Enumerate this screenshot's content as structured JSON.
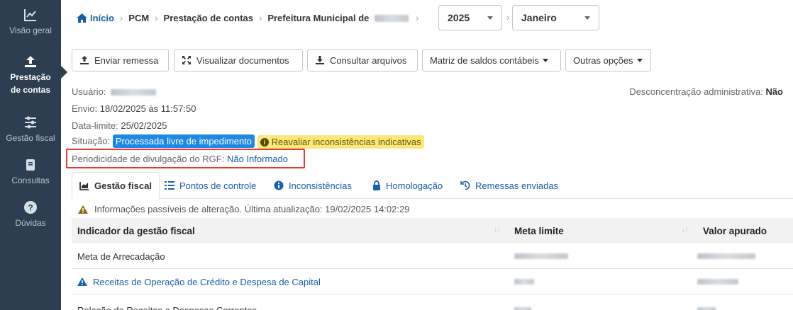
{
  "sidebar": {
    "items": [
      {
        "label": "Visão geral",
        "icon": "chart-line-icon"
      },
      {
        "label": "Prestação de contas",
        "icon": "upload-icon",
        "active": true
      },
      {
        "label": "Gestão fiscal",
        "icon": "sliders-icon"
      },
      {
        "label": "Consultas",
        "icon": "book-icon"
      },
      {
        "label": "Dúvidas",
        "icon": "question-icon"
      }
    ]
  },
  "breadcrumb": {
    "home": "Início",
    "items": [
      "PCM",
      "Prestação de contas",
      "Prefeitura Municipal de"
    ],
    "year": "2025",
    "month": "Janeiro"
  },
  "toolbar": {
    "send": "Enviar remessa",
    "view_docs": "Visualizar documentos",
    "query_files": "Consultar arquivos",
    "balances": "Matriz de saldos contábeis",
    "other": "Outras opções"
  },
  "info": {
    "user_label": "Usuário:",
    "sent_label": "Envio:",
    "sent_value": "18/02/2025 às 11:57:50",
    "deadline_label": "Data-limite:",
    "deadline_value": "25/02/2025",
    "status_label": "Situação:",
    "status_badge": "Processada livre de impedimento",
    "status_warning": "Reavaliar inconsistências indicativas",
    "rgf_label": "Periodicidade de divulgação do RGF:",
    "rgf_value": "Não Informado",
    "deconc_label": "Desconcentração administrativa:",
    "deconc_value": "Não"
  },
  "tabs": [
    {
      "label": "Gestão fiscal",
      "icon": "chart-area-icon",
      "active": true
    },
    {
      "label": "Pontos de controle",
      "icon": "list-icon"
    },
    {
      "label": "Inconsistências",
      "icon": "info-icon"
    },
    {
      "label": "Homologação",
      "icon": "lock-icon"
    },
    {
      "label": "Remessas enviadas",
      "icon": "history-icon"
    }
  ],
  "notice": "Informações passíveis de alteração. Última atualização: 19/02/2025 14:02:29",
  "table": {
    "headers": [
      "Indicador da gestão fiscal",
      "Meta limite",
      "Valor apurado"
    ],
    "rows": [
      {
        "indicator": "Meta de Arrecadação",
        "link": false
      },
      {
        "indicator": "Receitas de Operação de Crédito e Despesa de Capital",
        "link": true
      },
      {
        "indicator": "Relação de Receitas e Despesas Correntes",
        "link": false
      }
    ]
  },
  "colors": {
    "sidebar": "#2c3e50",
    "link": "#1a5fa8",
    "badge_blue": "#1e88e5",
    "badge_yellow": "#fce77a",
    "highlight": "#e53935"
  }
}
